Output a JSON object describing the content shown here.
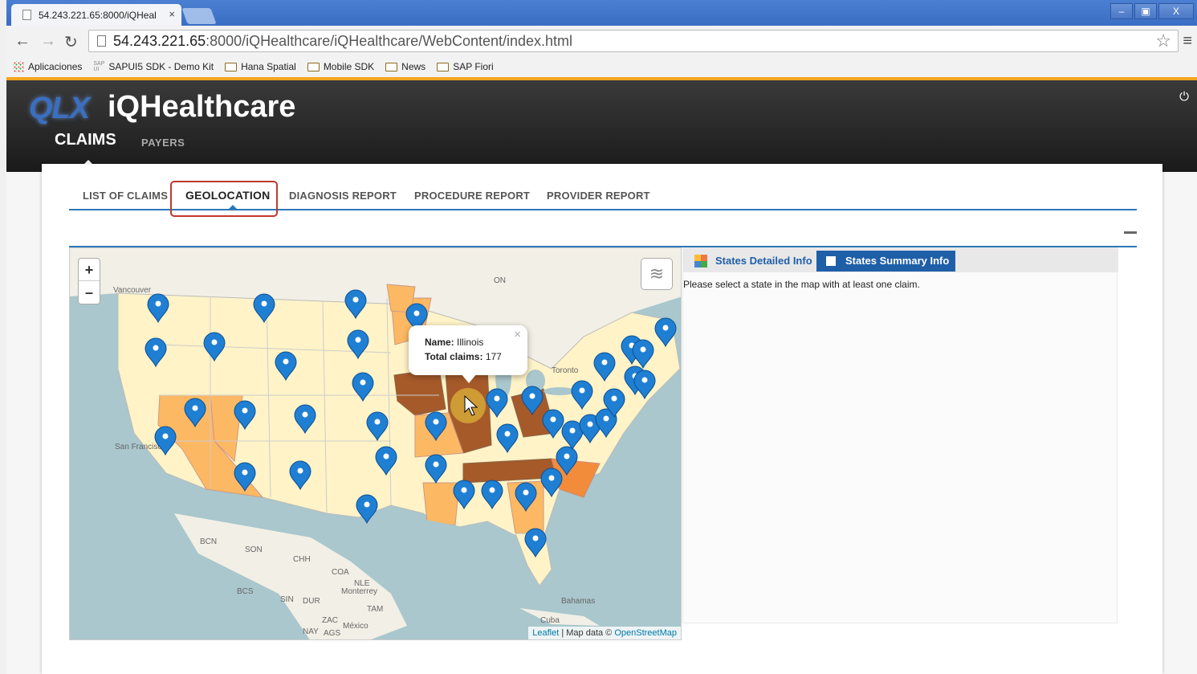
{
  "browser": {
    "tab_title": "54.243.221.65:8000/iQHeal",
    "tab_close": "×",
    "url_host": "54.243.221.65",
    "url_rest": ":8000/iQHealthcare/iQHealthcare/WebContent/index.html",
    "window_buttons": [
      "–",
      "▣",
      "X"
    ],
    "bookmarks": [
      {
        "label": "Aplicaciones",
        "icon": "apps-grid-icon"
      },
      {
        "label": "SAPUI5 SDK - Demo Kit",
        "icon": "sap-icon"
      },
      {
        "label": "Hana Spatial",
        "icon": "folder-icon"
      },
      {
        "label": "Mobile SDK",
        "icon": "folder-icon"
      },
      {
        "label": "News",
        "icon": "folder-icon"
      },
      {
        "label": "SAP Fiori",
        "icon": "folder-icon"
      }
    ]
  },
  "app": {
    "logo": "QLX",
    "title": "iQHealthcare",
    "nav": {
      "claims": "CLAIMS",
      "payers": "PAYERS"
    },
    "subtabs": [
      "LIST OF CLAIMS",
      "GEOLOCATION",
      "DIAGNOSIS REPORT",
      "PROCEDURE REPORT",
      "PROVIDER REPORT"
    ],
    "active_subtab": "GEOLOCATION",
    "accent_color": "#f3a51e",
    "link_color": "#2b78b6"
  },
  "map": {
    "zoom_in": "+",
    "zoom_out": "–",
    "popup": {
      "name_label": "Name:",
      "name_value": "Illinois",
      "claims_label": "Total claims:",
      "claims_value": "177",
      "close": "×"
    },
    "attribution": {
      "leaflet": "Leaflet",
      "sep": " | Map data © ",
      "osm": "OpenStreetMap"
    },
    "labels": [
      "ON",
      "Vancouver",
      "Toronto",
      "San Francisco",
      "BCN",
      "SON",
      "CHH",
      "COA",
      "NLE",
      "Monterrey",
      "BCS",
      "SIN",
      "DUR",
      "TAM",
      "ZAC",
      "México",
      "NAY",
      "AGS",
      "Bahamas",
      "Cuba"
    ],
    "colors": {
      "water": "#a9c7cc",
      "land": "#f2efe6",
      "low": "#fff3c7",
      "mid": "#fdb863",
      "high": "#f28c3a",
      "top": "#a65a2a",
      "marker": "#1f7fd3"
    }
  },
  "info_panel": {
    "tab_detailed": "States Detailed Info",
    "tab_summary": "States Summary Info",
    "message": "Please select a state in the map with at least one claim."
  }
}
